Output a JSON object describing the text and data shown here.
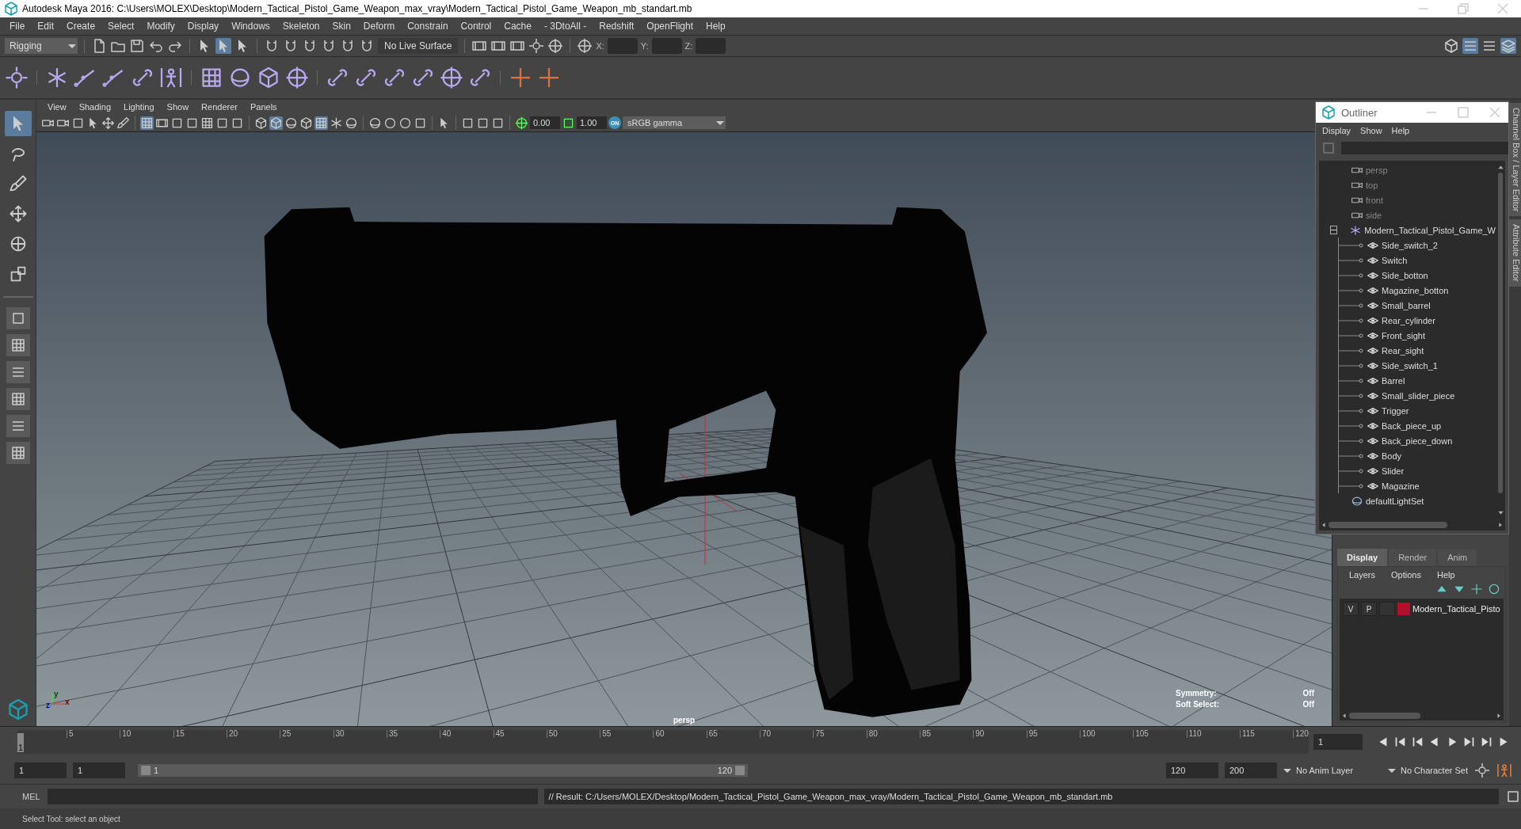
{
  "window": {
    "title": "Autodesk Maya 2016: C:\\Users\\MOLEX\\Desktop\\Modern_Tactical_Pistol_Game_Weapon_max_vray\\Modern_Tactical_Pistol_Game_Weapon_mb_standart.mb"
  },
  "menu_bar": [
    "File",
    "Edit",
    "Create",
    "Select",
    "Modify",
    "Display",
    "Windows",
    "Skeleton",
    "Skin",
    "Deform",
    "Constrain",
    "Control",
    "Cache",
    "- 3DtoAll -",
    "Redshift",
    "OpenFlight",
    "Help"
  ],
  "status_line": {
    "menu_set": "Rigging",
    "live_surface": "No Live Surface",
    "coords": [
      {
        "label": "X:"
      },
      {
        "label": "Y:"
      },
      {
        "label": "Z:"
      }
    ]
  },
  "toolbox": [
    {
      "selected": true
    },
    {
      "selected": false
    },
    {
      "selected": false
    },
    {
      "selected": false
    },
    {
      "selected": false
    },
    {
      "selected": false
    }
  ],
  "viewport": {
    "menus": [
      "View",
      "Shading",
      "Lighting",
      "Show",
      "Renderer",
      "Panels"
    ],
    "exposure": "0.00",
    "gamma": "1.00",
    "color_management": "ON",
    "color_space": "sRGB gamma",
    "camera": "persp",
    "axis_labels": [
      "x",
      "y",
      "z"
    ],
    "hud": [
      {
        "label": "Symmetry:",
        "value": "Off"
      },
      {
        "label": "Soft Select:",
        "value": "Off"
      }
    ]
  },
  "outliner": {
    "title": "Outliner",
    "menus": [
      "Display",
      "Show",
      "Help"
    ],
    "items": [
      {
        "name": "persp",
        "kind": "camera"
      },
      {
        "name": "top",
        "kind": "camera"
      },
      {
        "name": "front",
        "kind": "camera"
      },
      {
        "name": "side",
        "kind": "camera"
      },
      {
        "name": "Modern_Tactical_Pistol_Game_W",
        "kind": "group",
        "expanded": true,
        "children": [
          {
            "name": "Side_switch_2",
            "kind": "mesh"
          },
          {
            "name": "Switch",
            "kind": "mesh"
          },
          {
            "name": "Side_botton",
            "kind": "mesh"
          },
          {
            "name": "Magazine_botton",
            "kind": "mesh"
          },
          {
            "name": "Small_barrel",
            "kind": "mesh"
          },
          {
            "name": "Rear_cylinder",
            "kind": "mesh"
          },
          {
            "name": "Front_sight",
            "kind": "mesh"
          },
          {
            "name": "Rear_sight",
            "kind": "mesh"
          },
          {
            "name": "Side_switch_1",
            "kind": "mesh"
          },
          {
            "name": "Barrel",
            "kind": "mesh"
          },
          {
            "name": "Small_slider_piece",
            "kind": "mesh"
          },
          {
            "name": "Trigger",
            "kind": "mesh"
          },
          {
            "name": "Back_piece_up",
            "kind": "mesh"
          },
          {
            "name": "Back_piece_down",
            "kind": "mesh"
          },
          {
            "name": "Body",
            "kind": "mesh"
          },
          {
            "name": "Slider",
            "kind": "mesh"
          },
          {
            "name": "Magazine",
            "kind": "mesh"
          }
        ]
      },
      {
        "name": "defaultLightSet",
        "kind": "set"
      }
    ]
  },
  "side_tabs": [
    "Channel Box / Layer Editor",
    "Attribute Editor"
  ],
  "layer_editor": {
    "tabs": [
      {
        "label": "Display",
        "selected": true
      },
      {
        "label": "Render",
        "selected": false
      },
      {
        "label": "Anim",
        "selected": false
      }
    ],
    "menus": [
      "Layers",
      "Options",
      "Help"
    ],
    "layers": [
      {
        "visibility": "V",
        "playback": "P",
        "color": "#b0102c",
        "name": "Modern_Tactical_Pisto"
      }
    ]
  },
  "timeline": {
    "level": 0,
    "start": "1",
    "ticks": [
      "5",
      "10",
      "15",
      "20",
      "25",
      "30",
      "35",
      "40",
      "45",
      "50",
      "55",
      "60",
      "65",
      "70",
      "75",
      "80",
      "85",
      "90",
      "95",
      "100",
      "105",
      "110",
      "115",
      "120"
    ],
    "current_frame": "1"
  },
  "range": {
    "level": 1,
    "start": "1",
    "playback_start": "1",
    "slider_start": "1",
    "slider_end": "120",
    "playback_end": "120",
    "end": "200",
    "anim_layer": "No Anim Layer",
    "character_set": "No Character Set"
  },
  "command_line": {
    "language": "MEL",
    "result": "// Result: C:/Users/MOLEX/Desktop/Modern_Tactical_Pistol_Game_Weapon_max_vray/Modern_Tactical_Pistol_Game_Weapon_mb_standart.mb"
  },
  "help_line": "Select Tool: select an object"
}
